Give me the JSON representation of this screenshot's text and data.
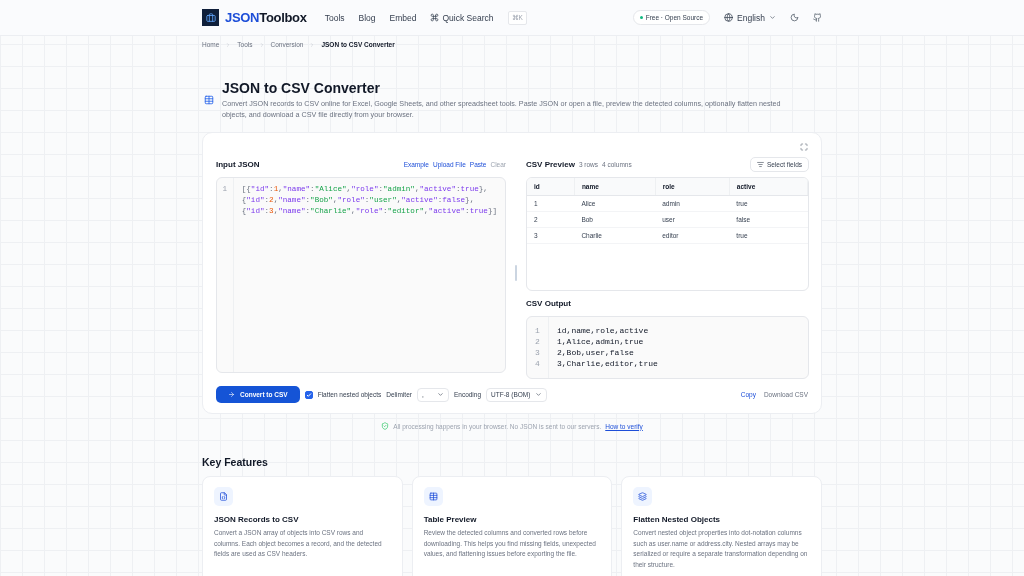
{
  "header": {
    "logo": "JSON",
    "logo_suffix": "Toolbox",
    "nav": [
      "Tools",
      "Blog",
      "Embed"
    ],
    "quick_search": "Quick Search",
    "shortcut": "⌘K",
    "badge": "Free · Open Source",
    "language": "English"
  },
  "breadcrumb": [
    "Home",
    "Tools",
    "Conversion",
    "JSON to CSV Converter"
  ],
  "page": {
    "title": "JSON to CSV Converter",
    "description": "Convert JSON records to CSV online for Excel, Google Sheets, and other spreadsheet tools. Paste JSON or open a file, preview the detected columns, optionally flatten nested objects, and download a CSV file directly from your browser."
  },
  "input": {
    "title": "Input JSON",
    "actions": [
      {
        "label": "Example",
        "disabled": false
      },
      {
        "label": "Upload File",
        "disabled": false
      },
      {
        "label": "Paste",
        "disabled": false
      },
      {
        "label": "Clear",
        "disabled": true
      }
    ],
    "line_numbers": [
      "1"
    ],
    "lines": [
      "[{\"id\":1,\"name\":\"Alice\",\"role\":\"admin\",\"active\":true},",
      "{\"id\":2,\"name\":\"Bob\",\"role\":\"user\",\"active\":false},",
      "{\"id\":3,\"name\":\"Charlie\",\"role\":\"editor\",\"active\":true}]"
    ]
  },
  "preview": {
    "title": "CSV Preview",
    "rows_count": "3 rows",
    "columns_count": "4 columns",
    "select_fields": "Select fields",
    "columns": [
      "id",
      "name",
      "role",
      "active"
    ],
    "rows": [
      [
        "1",
        "Alice",
        "admin",
        "true"
      ],
      [
        "2",
        "Bob",
        "user",
        "false"
      ],
      [
        "3",
        "Charlie",
        "editor",
        "true"
      ]
    ]
  },
  "output": {
    "title": "CSV Output",
    "lines": [
      {
        "number": "1",
        "text": "id,name,role,active"
      },
      {
        "number": "2",
        "text": "1,Alice,admin,true"
      },
      {
        "number": "3",
        "text": "2,Bob,user,false"
      },
      {
        "number": "4",
        "text": "3,Charlie,editor,true"
      }
    ]
  },
  "controls": {
    "convert": "Convert to CSV",
    "flatten": {
      "label": "Flatten nested objects",
      "checked": true
    },
    "delimiter_label": "Delimiter",
    "delimiter": ",",
    "encoding_label": "Encoding",
    "encoding": "UTF-8 (BOM)",
    "copy": "Copy",
    "download": "Download CSV"
  },
  "privacy": {
    "text": "All processing happens in your browser. No JSON is sent to our servers.",
    "link": "How to verify"
  },
  "features": {
    "title": "Key Features",
    "items": [
      {
        "kind": "file",
        "title": "JSON Records to CSV",
        "text": "Convert a JSON array of objects into CSV rows and columns. Each object becomes a record, and the detected fields are used as CSV headers."
      },
      {
        "kind": "table",
        "title": "Table Preview",
        "text": "Review the detected columns and converted rows before downloading. This helps you find missing fields, unexpected values, and flattening issues before exporting the file."
      },
      {
        "kind": "layers",
        "title": "Flatten Nested Objects",
        "text": "Convert nested object properties into dot-notation columns such as user.name or address.city. Nested arrays may be serialized or require a separate transformation depending on their structure."
      }
    ]
  }
}
